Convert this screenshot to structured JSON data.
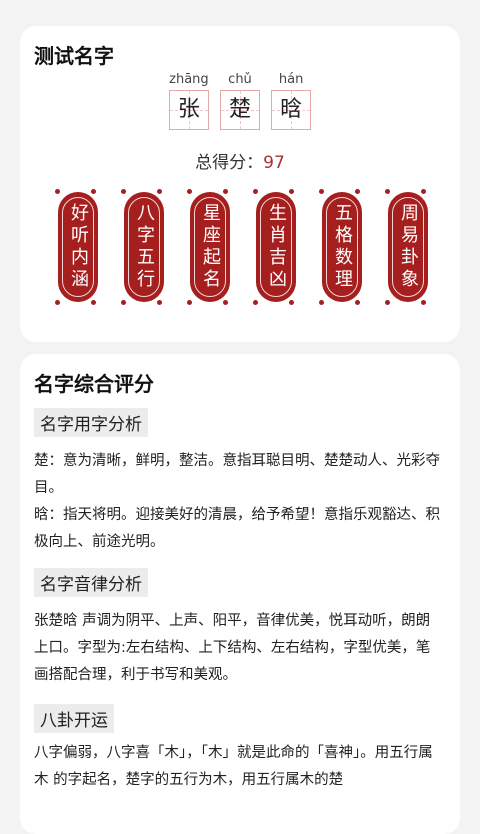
{
  "test_card": {
    "title": "测试名字",
    "name_chars": [
      {
        "pinyin": "zhāng",
        "char": "张"
      },
      {
        "pinyin": "chǔ",
        "char": "楚"
      },
      {
        "pinyin": "hán",
        "char": "晗"
      }
    ],
    "score_label": "总得分：",
    "score_value": "97",
    "tags": [
      "好听内涵",
      "八字五行",
      "星座起名",
      "生肖吉凶",
      "五格数理",
      "周易卦象"
    ]
  },
  "eval_card": {
    "title": "名字综合评分",
    "sections": [
      {
        "heading": "名字用字分析",
        "paragraphs": [
          "楚：意为清晰，鲜明，整洁。意指耳聪目明、楚楚动人、光彩夺目。",
          "晗：指天将明。迎接美好的清晨，给予希望！意指乐观豁达、积极向上、前途光明。"
        ]
      },
      {
        "heading": "名字音律分析",
        "paragraphs": [
          "张楚晗 声调为阴平、上声、阳平，音律优美，悦耳动听，朗朗上口。字型为:左右结构、上下结构、左右结构，字型优美，笔画搭配合理，利于书写和美观。"
        ]
      },
      {
        "heading": "八卦开运",
        "paragraphs": [
          "八字偏弱，八字喜「木」，「木」就是此命的「喜神」。用五行属木 的字起名，楚字的五行为木，用五行属木的楚"
        ]
      }
    ]
  },
  "colors": {
    "accent_red": "#a51f1f",
    "score_red": "#a83232",
    "page_bg": "#f3f3f3"
  }
}
